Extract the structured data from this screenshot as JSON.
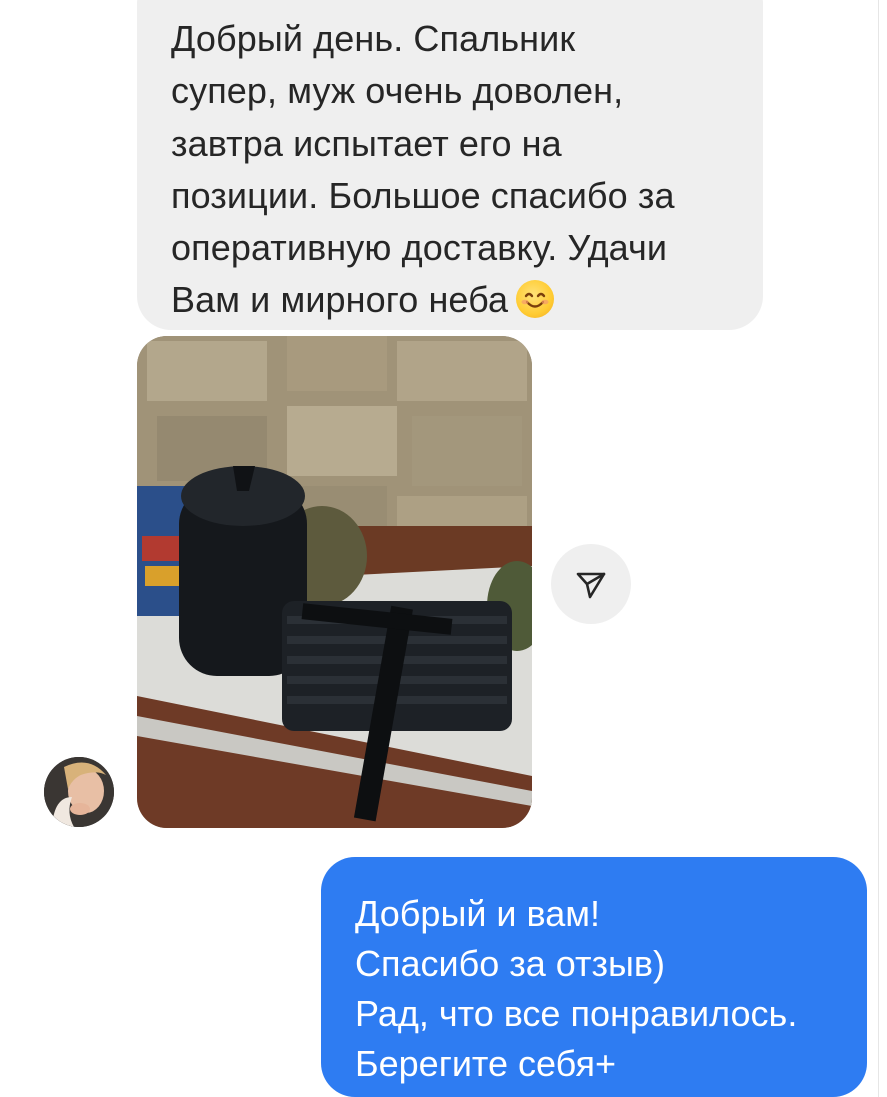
{
  "conversation": {
    "incoming": {
      "lines": [
        "Добрый день. Спальник",
        "супер, муж очень доволен,",
        "завтра испытает его на",
        "позиции. Большое спасибо за",
        "оперативную доставку. Удачи",
        "Вам и мирного неба"
      ],
      "emoji": "smiling-face-icon"
    },
    "photo": {
      "subject": "photo"
    },
    "share_icon": "paper-plane-icon",
    "avatar_icon": "contact-avatar",
    "outgoing": {
      "lines": [
        "Добрый и вам!",
        "Спасибо за отзыв)",
        "Рад, что все понравилось.",
        "Берегите себя+"
      ]
    }
  },
  "colors": {
    "incoming_bubble": "#efefef",
    "outgoing_bubble": "#2e7cf2",
    "incoming_text": "#262626",
    "outgoing_text": "#ffffff"
  }
}
